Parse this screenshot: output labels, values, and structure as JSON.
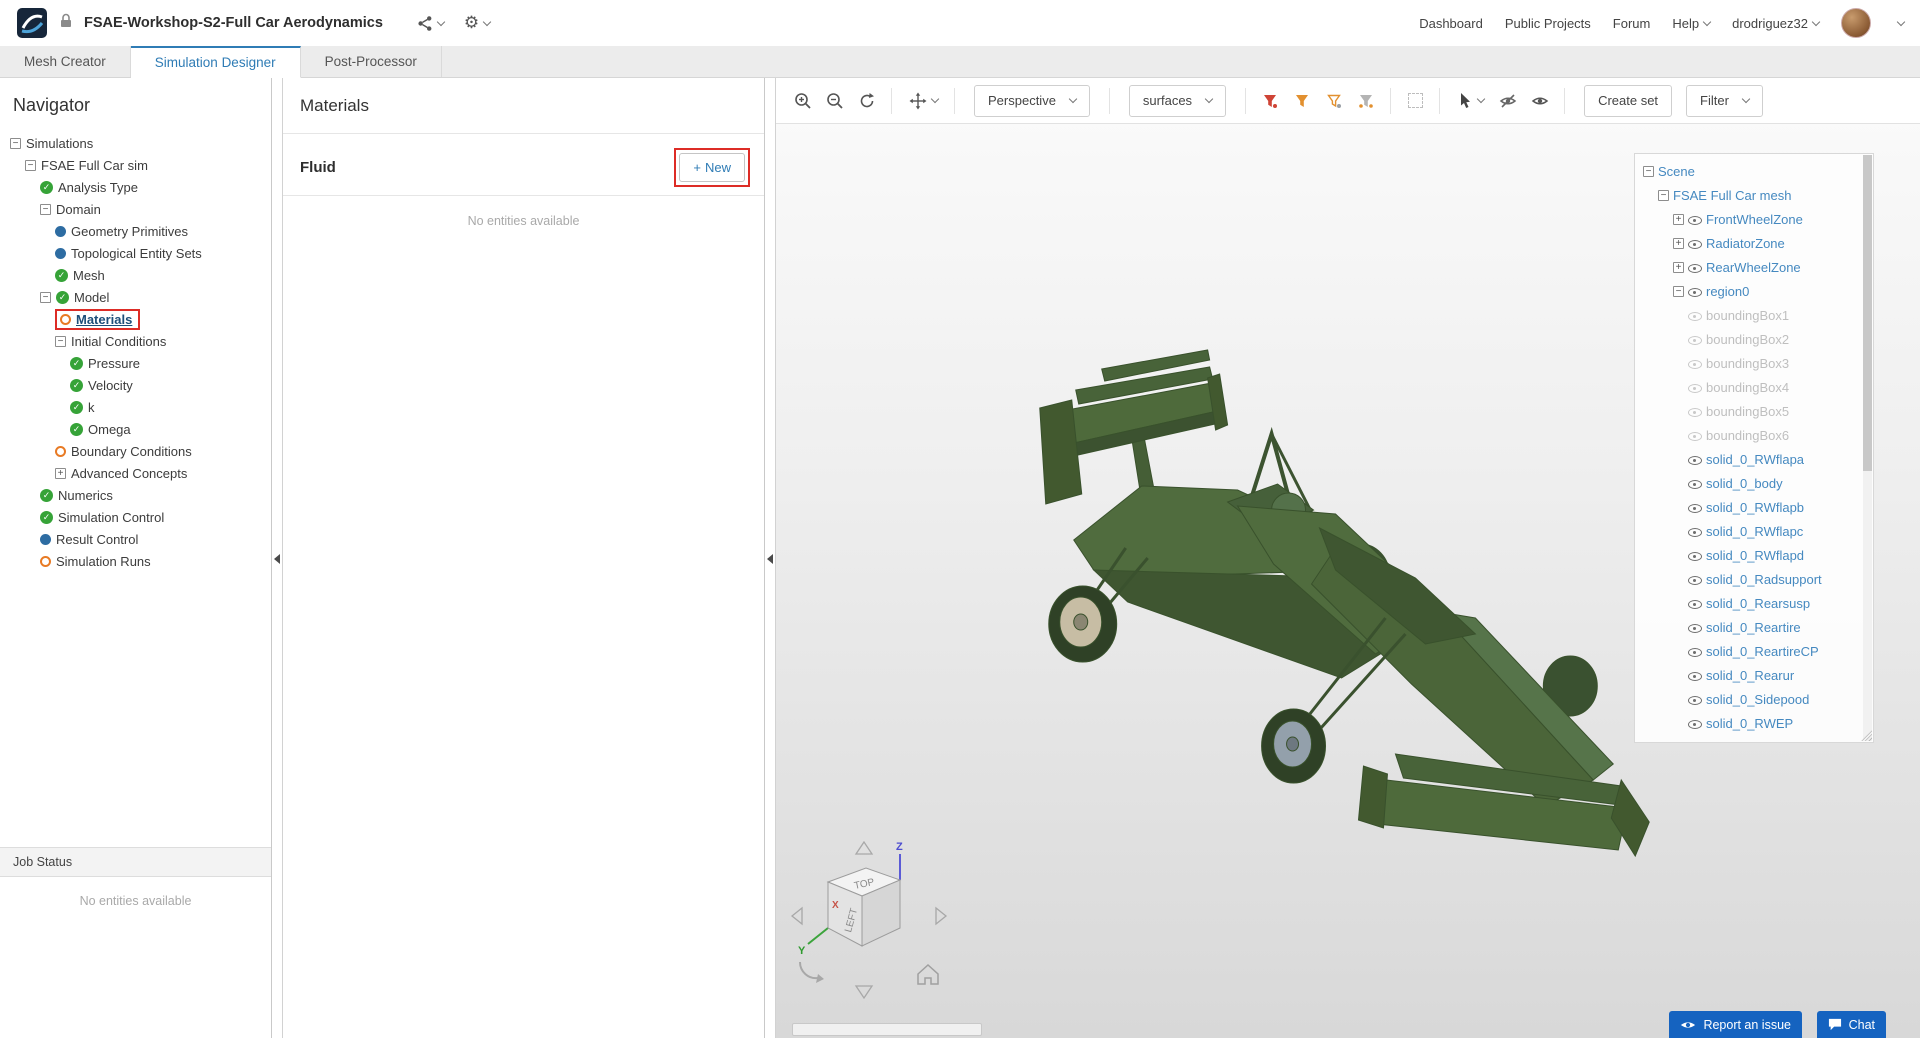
{
  "header": {
    "title": "FSAE-Workshop-S2-Full Car Aerodynamics",
    "nav_items": [
      "Dashboard",
      "Public Projects",
      "Forum",
      "Help",
      "drodriguez32"
    ]
  },
  "tabs": [
    "Mesh Creator",
    "Simulation Designer",
    "Post-Processor"
  ],
  "active_tab": "Simulation Designer",
  "navigator": {
    "title": "Navigator",
    "tree": [
      {
        "label": "Simulations",
        "indent": 0,
        "expander": "minus"
      },
      {
        "label": "FSAE Full Car sim",
        "indent": 1,
        "expander": "minus"
      },
      {
        "label": "Analysis Type",
        "indent": 2,
        "status": "check"
      },
      {
        "label": "Domain",
        "indent": 2,
        "expander": "minus"
      },
      {
        "label": "Geometry Primitives",
        "indent": 3,
        "status": "blue"
      },
      {
        "label": "Topological Entity Sets",
        "indent": 3,
        "status": "blue"
      },
      {
        "label": "Mesh",
        "indent": 3,
        "status": "check"
      },
      {
        "label": "Model",
        "indent": 2,
        "expander": "minus",
        "status": "check"
      },
      {
        "label": "Materials",
        "indent": 3,
        "status": "orange",
        "selected": true
      },
      {
        "label": "Initial Conditions",
        "indent": 3,
        "expander": "minus"
      },
      {
        "label": "Pressure",
        "indent": 4,
        "status": "check"
      },
      {
        "label": "Velocity",
        "indent": 4,
        "status": "check"
      },
      {
        "label": "k",
        "indent": 4,
        "status": "check"
      },
      {
        "label": "Omega",
        "indent": 4,
        "status": "check"
      },
      {
        "label": "Boundary Conditions",
        "indent": 3,
        "status": "orange"
      },
      {
        "label": "Advanced Concepts",
        "indent": 3,
        "expander": "plus"
      },
      {
        "label": "Numerics",
        "indent": 2,
        "status": "check"
      },
      {
        "label": "Simulation Control",
        "indent": 2,
        "status": "check"
      },
      {
        "label": "Result Control",
        "indent": 2,
        "status": "blue"
      },
      {
        "label": "Simulation Runs",
        "indent": 2,
        "status": "orange"
      }
    ],
    "job_status_title": "Job Status",
    "job_status_empty": "No entities available"
  },
  "materials": {
    "title": "Materials",
    "section_title": "Fluid",
    "new_button": "New",
    "plus_glyph": "+",
    "empty_text": "No entities available"
  },
  "viewport": {
    "toolbar": {
      "perspective_label": "Perspective",
      "surfaces_label": "surfaces",
      "create_set_label": "Create set",
      "filter_label": "Filter"
    },
    "scene_tree": [
      {
        "label": "Scene",
        "indent": 0,
        "expander": "minus"
      },
      {
        "label": "FSAE Full Car mesh",
        "indent": 1,
        "expander": "minus"
      },
      {
        "label": "FrontWheelZone",
        "indent": 2,
        "expander": "plus",
        "eye": true
      },
      {
        "label": "RadiatorZone",
        "indent": 2,
        "expander": "plus",
        "eye": true
      },
      {
        "label": "RearWheelZone",
        "indent": 2,
        "expander": "plus",
        "eye": true
      },
      {
        "label": "region0",
        "indent": 2,
        "expander": "minus",
        "eye": true
      },
      {
        "label": "boundingBox1",
        "indent": 3,
        "eye": true,
        "dim": true
      },
      {
        "label": "boundingBox2",
        "indent": 3,
        "eye": true,
        "dim": true
      },
      {
        "label": "boundingBox3",
        "indent": 3,
        "eye": true,
        "dim": true
      },
      {
        "label": "boundingBox4",
        "indent": 3,
        "eye": true,
        "dim": true
      },
      {
        "label": "boundingBox5",
        "indent": 3,
        "eye": true,
        "dim": true
      },
      {
        "label": "boundingBox6",
        "indent": 3,
        "eye": true,
        "dim": true
      },
      {
        "label": "solid_0_RWflapa",
        "indent": 3,
        "eye": true
      },
      {
        "label": "solid_0_body",
        "indent": 3,
        "eye": true
      },
      {
        "label": "solid_0_RWflapb",
        "indent": 3,
        "eye": true
      },
      {
        "label": "solid_0_RWflapc",
        "indent": 3,
        "eye": true
      },
      {
        "label": "solid_0_RWflapd",
        "indent": 3,
        "eye": true
      },
      {
        "label": "solid_0_Radsupport",
        "indent": 3,
        "eye": true
      },
      {
        "label": "solid_0_Rearsusp",
        "indent": 3,
        "eye": true
      },
      {
        "label": "solid_0_Reartire",
        "indent": 3,
        "eye": true
      },
      {
        "label": "solid_0_ReartireCP",
        "indent": 3,
        "eye": true
      },
      {
        "label": "solid_0_Rearur",
        "indent": 3,
        "eye": true
      },
      {
        "label": "solid_0_Sidepood",
        "indent": 3,
        "eye": true
      },
      {
        "label": "solid_0_RWEP",
        "indent": 3,
        "eye": true
      }
    ],
    "cube": {
      "top_label": "TOP",
      "left_label": "LEFT",
      "x": "X",
      "y": "Y",
      "z": "Z"
    },
    "report_issue_label": "Report an issue",
    "chat_label": "Chat"
  },
  "colors": {
    "accent_blue": "#2f7cb5",
    "annotation_red": "#dd2c26",
    "status_green": "#36a338",
    "status_orange": "#e87a24",
    "status_blue": "#2d6ca2",
    "car_green": "#4e6a3b",
    "button_blue": "#1563c0"
  }
}
